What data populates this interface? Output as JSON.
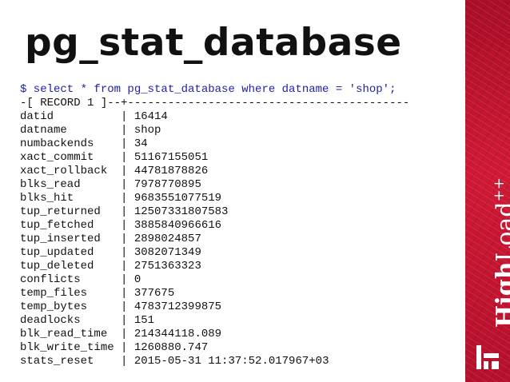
{
  "slide": {
    "title": "pg_stat_database"
  },
  "terminal": {
    "command": "$ select * from pg_stat_database where datname = 'shop';",
    "record_header": "-[ RECORD 1 ]--+------------------------------------------",
    "separator": "|",
    "rows": [
      {
        "key": "datid",
        "value": "16414"
      },
      {
        "key": "datname",
        "value": "shop"
      },
      {
        "key": "numbackends",
        "value": "34"
      },
      {
        "key": "xact_commit",
        "value": "51167155051"
      },
      {
        "key": "xact_rollback",
        "value": "44781878826"
      },
      {
        "key": "blks_read",
        "value": "7978770895"
      },
      {
        "key": "blks_hit",
        "value": "9683551077519"
      },
      {
        "key": "tup_returned",
        "value": "12507331807583"
      },
      {
        "key": "tup_fetched",
        "value": "3885840966616"
      },
      {
        "key": "tup_inserted",
        "value": "2898024857"
      },
      {
        "key": "tup_updated",
        "value": "3082071349"
      },
      {
        "key": "tup_deleted",
        "value": "2751363323"
      },
      {
        "key": "conflicts",
        "value": "0"
      },
      {
        "key": "temp_files",
        "value": "377675"
      },
      {
        "key": "temp_bytes",
        "value": "4783712399875"
      },
      {
        "key": "deadlocks",
        "value": "151"
      },
      {
        "key": "blk_read_time",
        "value": "214344118.089"
      },
      {
        "key": "blk_write_time",
        "value": "1260880.747"
      },
      {
        "key": "stats_reset",
        "value": "2015-05-31 11:37:52.017967+03"
      }
    ]
  },
  "brand": {
    "name_bold": "High",
    "name_regular": "Load",
    "name_sup": "++",
    "mark_icon": "highload-mark-icon",
    "colors": {
      "primary": "#c41230",
      "text": "#ffffff"
    }
  }
}
